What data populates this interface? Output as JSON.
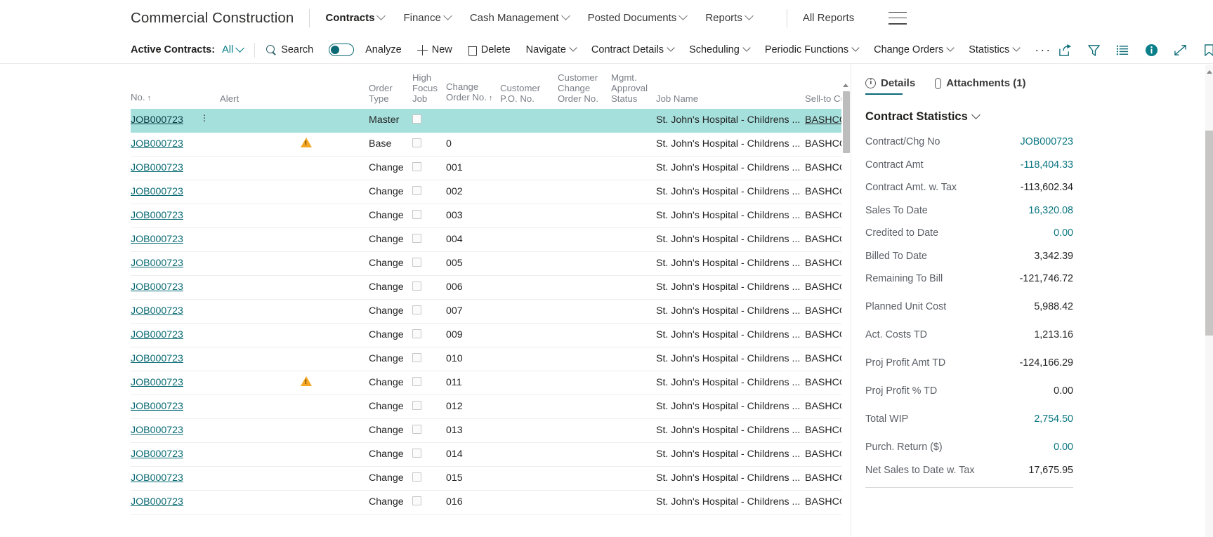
{
  "topnav": {
    "app_title": "Commercial Construction",
    "items": [
      {
        "label": "Contracts",
        "has_chevron": true,
        "active": true
      },
      {
        "label": "Finance",
        "has_chevron": true,
        "active": false
      },
      {
        "label": "Cash Management",
        "has_chevron": true,
        "active": false
      },
      {
        "label": "Posted Documents",
        "has_chevron": true,
        "active": false
      },
      {
        "label": "Reports",
        "has_chevron": true,
        "active": false
      }
    ],
    "all_reports_label": "All Reports",
    "menu_icon": "hamburger-icon"
  },
  "actionbar": {
    "filter_label": "Active Contracts:",
    "filter_value": "All",
    "search_label": "Search",
    "analyze_label": "Analyze",
    "analyze_toggle_on": false,
    "new_label": "New",
    "delete_label": "Delete",
    "menus": [
      {
        "label": "Navigate"
      },
      {
        "label": "Contract Details"
      },
      {
        "label": "Scheduling"
      },
      {
        "label": "Periodic Functions"
      },
      {
        "label": "Change Orders"
      },
      {
        "label": "Statistics"
      }
    ],
    "overflow_label": "···",
    "right_icons": [
      "share-icon",
      "filter-icon",
      "list-icon",
      "info-filled-icon",
      "expand-icon",
      "bookmark-icon"
    ]
  },
  "grid": {
    "columns": [
      {
        "key": "no",
        "label": "No.",
        "sort": "↑"
      },
      {
        "key": "menu",
        "label": ""
      },
      {
        "key": "alert",
        "label": "Alert"
      },
      {
        "key": "otype",
        "label": "Order Type"
      },
      {
        "key": "hfj",
        "label": "High\nFocus\nJob"
      },
      {
        "key": "cono",
        "label": "Change\nOrder No.",
        "sort": "↑"
      },
      {
        "key": "cpo",
        "label": "Customer\nP.O. No."
      },
      {
        "key": "ccon",
        "label": "Customer\nChange\nOrder No."
      },
      {
        "key": "mas",
        "label": "Mgmt.\nApproval\nStatus"
      },
      {
        "key": "job",
        "label": "Job Name"
      },
      {
        "key": "sell",
        "label": "Sell-to Cust"
      }
    ],
    "rows": [
      {
        "no": "JOB000723",
        "alert": "",
        "otype": "Master",
        "hfj": false,
        "cono": "",
        "cpo": "",
        "ccon": "",
        "mas": "",
        "job": "St. John's Hospital - Childrens ...",
        "sell": "BASHCO",
        "selected": true
      },
      {
        "no": "JOB000723",
        "alert": "warn",
        "otype": "Base",
        "hfj": false,
        "cono": "0",
        "cpo": "",
        "ccon": "",
        "mas": "",
        "job": "St. John's Hospital - Childrens ...",
        "sell": "BASHCO",
        "selected": false
      },
      {
        "no": "JOB000723",
        "alert": "",
        "otype": "Change",
        "hfj": false,
        "cono": "001",
        "cpo": "",
        "ccon": "",
        "mas": "",
        "job": "St. John's Hospital - Childrens ...",
        "sell": "BASHCO",
        "selected": false
      },
      {
        "no": "JOB000723",
        "alert": "",
        "otype": "Change",
        "hfj": false,
        "cono": "002",
        "cpo": "",
        "ccon": "",
        "mas": "",
        "job": "St. John's Hospital - Childrens ...",
        "sell": "BASHCO",
        "selected": false
      },
      {
        "no": "JOB000723",
        "alert": "",
        "otype": "Change",
        "hfj": false,
        "cono": "003",
        "cpo": "",
        "ccon": "",
        "mas": "",
        "job": "St. John's Hospital - Childrens ...",
        "sell": "BASHCO",
        "selected": false
      },
      {
        "no": "JOB000723",
        "alert": "",
        "otype": "Change",
        "hfj": false,
        "cono": "004",
        "cpo": "",
        "ccon": "",
        "mas": "",
        "job": "St. John's Hospital - Childrens ...",
        "sell": "BASHCO",
        "selected": false
      },
      {
        "no": "JOB000723",
        "alert": "",
        "otype": "Change",
        "hfj": false,
        "cono": "005",
        "cpo": "",
        "ccon": "",
        "mas": "",
        "job": "St. John's Hospital - Childrens ...",
        "sell": "BASHCO",
        "selected": false
      },
      {
        "no": "JOB000723",
        "alert": "",
        "otype": "Change",
        "hfj": false,
        "cono": "006",
        "cpo": "",
        "ccon": "",
        "mas": "",
        "job": "St. John's Hospital - Childrens ...",
        "sell": "BASHCO",
        "selected": false
      },
      {
        "no": "JOB000723",
        "alert": "",
        "otype": "Change",
        "hfj": false,
        "cono": "007",
        "cpo": "",
        "ccon": "",
        "mas": "",
        "job": "St. John's Hospital - Childrens ...",
        "sell": "BASHCO",
        "selected": false
      },
      {
        "no": "JOB000723",
        "alert": "",
        "otype": "Change",
        "hfj": false,
        "cono": "009",
        "cpo": "",
        "ccon": "",
        "mas": "",
        "job": "St. John's Hospital - Childrens ...",
        "sell": "BASHCO",
        "selected": false
      },
      {
        "no": "JOB000723",
        "alert": "",
        "otype": "Change",
        "hfj": false,
        "cono": "010",
        "cpo": "",
        "ccon": "",
        "mas": "",
        "job": "St. John's Hospital - Childrens ...",
        "sell": "BASHCO",
        "selected": false
      },
      {
        "no": "JOB000723",
        "alert": "warn",
        "otype": "Change",
        "hfj": false,
        "cono": "011",
        "cpo": "",
        "ccon": "",
        "mas": "",
        "job": "St. John's Hospital - Childrens ...",
        "sell": "BASHCO",
        "selected": false
      },
      {
        "no": "JOB000723",
        "alert": "",
        "otype": "Change",
        "hfj": false,
        "cono": "012",
        "cpo": "",
        "ccon": "",
        "mas": "",
        "job": "St. John's Hospital - Childrens ...",
        "sell": "BASHCO",
        "selected": false
      },
      {
        "no": "JOB000723",
        "alert": "",
        "otype": "Change",
        "hfj": false,
        "cono": "013",
        "cpo": "",
        "ccon": "",
        "mas": "",
        "job": "St. John's Hospital - Childrens ...",
        "sell": "BASHCO",
        "selected": false
      },
      {
        "no": "JOB000723",
        "alert": "",
        "otype": "Change",
        "hfj": false,
        "cono": "014",
        "cpo": "",
        "ccon": "",
        "mas": "",
        "job": "St. John's Hospital - Childrens ...",
        "sell": "BASHCO",
        "selected": false
      },
      {
        "no": "JOB000723",
        "alert": "",
        "otype": "Change",
        "hfj": false,
        "cono": "015",
        "cpo": "",
        "ccon": "",
        "mas": "",
        "job": "St. John's Hospital - Childrens ...",
        "sell": "BASHCO",
        "selected": false
      },
      {
        "no": "JOB000723",
        "alert": "",
        "otype": "Change",
        "hfj": false,
        "cono": "016",
        "cpo": "",
        "ccon": "",
        "mas": "",
        "job": "St. John's Hospital - Childrens ...",
        "sell": "BASHCO",
        "selected": false
      }
    ]
  },
  "details": {
    "tabs": [
      {
        "label": "Details",
        "icon": "info-circle-icon",
        "active": true
      },
      {
        "label": "Attachments (1)",
        "icon": "paperclip-icon",
        "active": false
      }
    ],
    "section_title": "Contract Statistics",
    "fields": [
      {
        "label": "Contract/Chg No",
        "value": "JOB000723",
        "link": true,
        "gap": false
      },
      {
        "label": "Contract Amt",
        "value": "-118,404.33",
        "link": true,
        "gap": false
      },
      {
        "label": "Contract Amt. w. Tax",
        "value": "-113,602.34",
        "link": false,
        "gap": false
      },
      {
        "label": "Sales To Date",
        "value": "16,320.08",
        "link": true,
        "gap": false
      },
      {
        "label": "Credited to Date",
        "value": "0.00",
        "link": true,
        "gap": false
      },
      {
        "label": "Billed To Date",
        "value": "3,342.39",
        "link": false,
        "gap": false
      },
      {
        "label": "Remaining To Bill",
        "value": "-121,746.72",
        "link": false,
        "gap": false
      },
      {
        "label": "Planned Unit Cost",
        "value": "5,988.42",
        "link": false,
        "gap": true
      },
      {
        "label": "Act. Costs TD",
        "value": "1,213.16",
        "link": false,
        "gap": true
      },
      {
        "label": "Proj Profit Amt TD",
        "value": "-124,166.29",
        "link": false,
        "gap": true
      },
      {
        "label": "Proj Profit % TD",
        "value": "0.00",
        "link": false,
        "gap": true
      },
      {
        "label": "Total WIP",
        "value": "2,754.50",
        "link": true,
        "gap": true
      },
      {
        "label": "Purch. Return ($)",
        "value": "0.00",
        "link": true,
        "gap": true
      },
      {
        "label": "Net Sales to Date w. Tax",
        "value": "17,675.95",
        "link": false,
        "gap": false
      }
    ]
  },
  "colors": {
    "accent": "#0b6a75",
    "link": "#0a7680",
    "selected_row": "#a5e0dd",
    "warning": "#f5a623"
  }
}
